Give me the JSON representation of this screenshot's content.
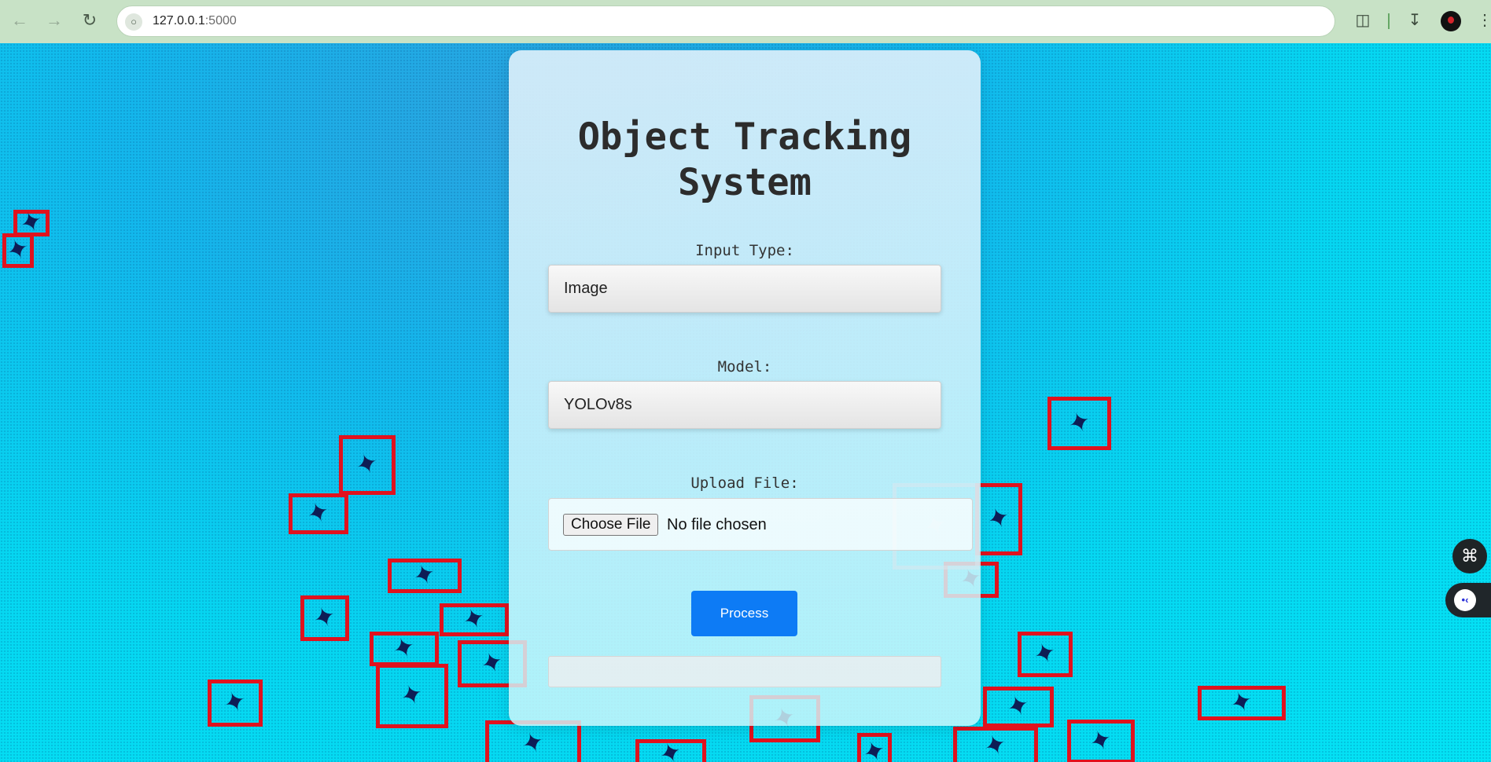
{
  "browser": {
    "back_icon": "arrow-left-icon",
    "forward_icon": "arrow-right-icon",
    "reload_icon": "reload-icon",
    "url_host": "127.0.0.1",
    "url_port": ":5000"
  },
  "page": {
    "title": "Object Tracking System",
    "input_type_label": "Input Type:",
    "input_type_value": "Image",
    "model_label": "Model:",
    "model_value": "YOLOv8s",
    "upload_label": "Upload File:",
    "choose_file_label": "Choose File",
    "no_file_text": "No file chosen",
    "process_label": "Process",
    "status_text": ""
  },
  "colors": {
    "accent": "#0d7bf5",
    "bbox": "#e0121e",
    "chrome": "#c8e2c6"
  }
}
